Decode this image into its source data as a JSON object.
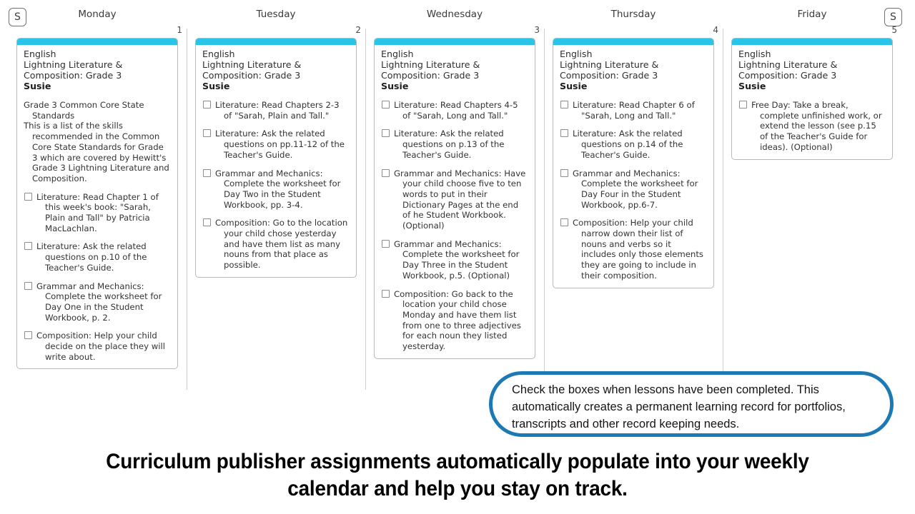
{
  "header": {
    "left_button_label": "S",
    "right_button_label": "S",
    "days": [
      {
        "label": "Monday",
        "number": "1"
      },
      {
        "label": "Tuesday",
        "number": "2"
      },
      {
        "label": "Wednesday",
        "number": "3"
      },
      {
        "label": "Thursday",
        "number": "4"
      },
      {
        "label": "Friday",
        "number": "5"
      }
    ]
  },
  "colors": {
    "card_accent": "#2ac4e9",
    "callout_border": "#1c79b3",
    "card_border": "#b9b9b9",
    "column_separator": "#cfcfcf"
  },
  "columns": [
    {
      "course_line1": "English",
      "course_line2": "Lightning Literature &",
      "course_line3": "Composition: Grade 3",
      "student": "Susie",
      "tasks": [
        {
          "checkbox": false,
          "text": "Grade 3 Common Core State Standards"
        },
        {
          "checkbox": false,
          "text": "This is a list of the skills recommended in the Common Core State Standards for Grade 3 which are covered by Hewitt's Grade 3 Lightning Literature and Composition.",
          "flush": true
        },
        {
          "checkbox": true,
          "text": "Literature: Read Chapter 1 of this week's book: \"Sarah, Plain and Tall\" by Patricia MacLachlan."
        },
        {
          "checkbox": true,
          "text": "Literature: Ask the related questions on p.10 of the Teacher's Guide."
        },
        {
          "checkbox": true,
          "text": "Grammar and Mechanics: Complete the worksheet for Day One in the Student Workbook, p. 2."
        },
        {
          "checkbox": true,
          "text": "Composition: Help your child decide on the place they will write about."
        }
      ]
    },
    {
      "course_line1": "English",
      "course_line2": "Lightning Literature &",
      "course_line3": "Composition: Grade 3",
      "student": "Susie",
      "tasks": [
        {
          "checkbox": true,
          "text": "Literature: Read Chapters 2-3 of \"Sarah, Plain and Tall.\""
        },
        {
          "checkbox": true,
          "text": "Literature: Ask the related questions on pp.11-12 of the Teacher's Guide."
        },
        {
          "checkbox": true,
          "text": "Grammar and Mechanics: Complete the worksheet for Day Two in the Student Workbook, pp. 3-4."
        },
        {
          "checkbox": true,
          "text": "Composition: Go to the location your child chose yesterday and have them list as many nouns from that place as possible."
        }
      ]
    },
    {
      "course_line1": "English",
      "course_line2": "Lightning Literature &",
      "course_line3": "Composition: Grade 3",
      "student": "Susie",
      "tasks": [
        {
          "checkbox": true,
          "text": "Literature: Read Chapters 4-5 of \"Sarah, Long and Tall.\""
        },
        {
          "checkbox": true,
          "text": "Literature: Ask the related questions on p.13 of the Teacher's Guide."
        },
        {
          "checkbox": true,
          "text": "Grammar and Mechanics: Have your child choose five to ten words to put in their Dictionary Pages at the end of he Student Workbook. (Optional)"
        },
        {
          "checkbox": true,
          "text": "Grammar and Mechanics: Complete the worksheet for Day Three in the Student Workbook, p.5. (Optional)"
        },
        {
          "checkbox": true,
          "text": "Composition: Go back to the location your child chose Monday and have them list from one to three adjectives for each noun they listed yesterday."
        }
      ]
    },
    {
      "course_line1": "English",
      "course_line2": "Lightning Literature &",
      "course_line3": "Composition: Grade 3",
      "student": "Susie",
      "tasks": [
        {
          "checkbox": true,
          "text": "Literature: Read Chapter 6 of \"Sarah, Long and Tall.\""
        },
        {
          "checkbox": true,
          "text": "Literature: Ask the related questions on p.14 of the Teacher's Guide."
        },
        {
          "checkbox": true,
          "text": "Grammar and Mechanics: Complete the worksheet for Day Four in the Student Workbook, pp.6-7."
        },
        {
          "checkbox": true,
          "text": "Composition: Help your child narrow down their list of nouns and verbs so it includes only those elements they are going to include in their composition."
        }
      ]
    },
    {
      "course_line1": "English",
      "course_line2": "Lightning Literature &",
      "course_line3": "Composition: Grade 3",
      "student": "Susie",
      "tasks": [
        {
          "checkbox": true,
          "text": "Free Day: Take a break, complete unfinished work, or extend the lesson (see p.15 of the Teacher's Guide for ideas). (Optional)"
        }
      ]
    }
  ],
  "callout": {
    "text": "Check the boxes when lessons have been completed. This automatically creates a permanent learning record for portfolios, transcripts and other record keeping needs."
  },
  "caption": {
    "text": "Curriculum publisher assignments automatically populate into your weekly calendar and help you stay on track."
  }
}
